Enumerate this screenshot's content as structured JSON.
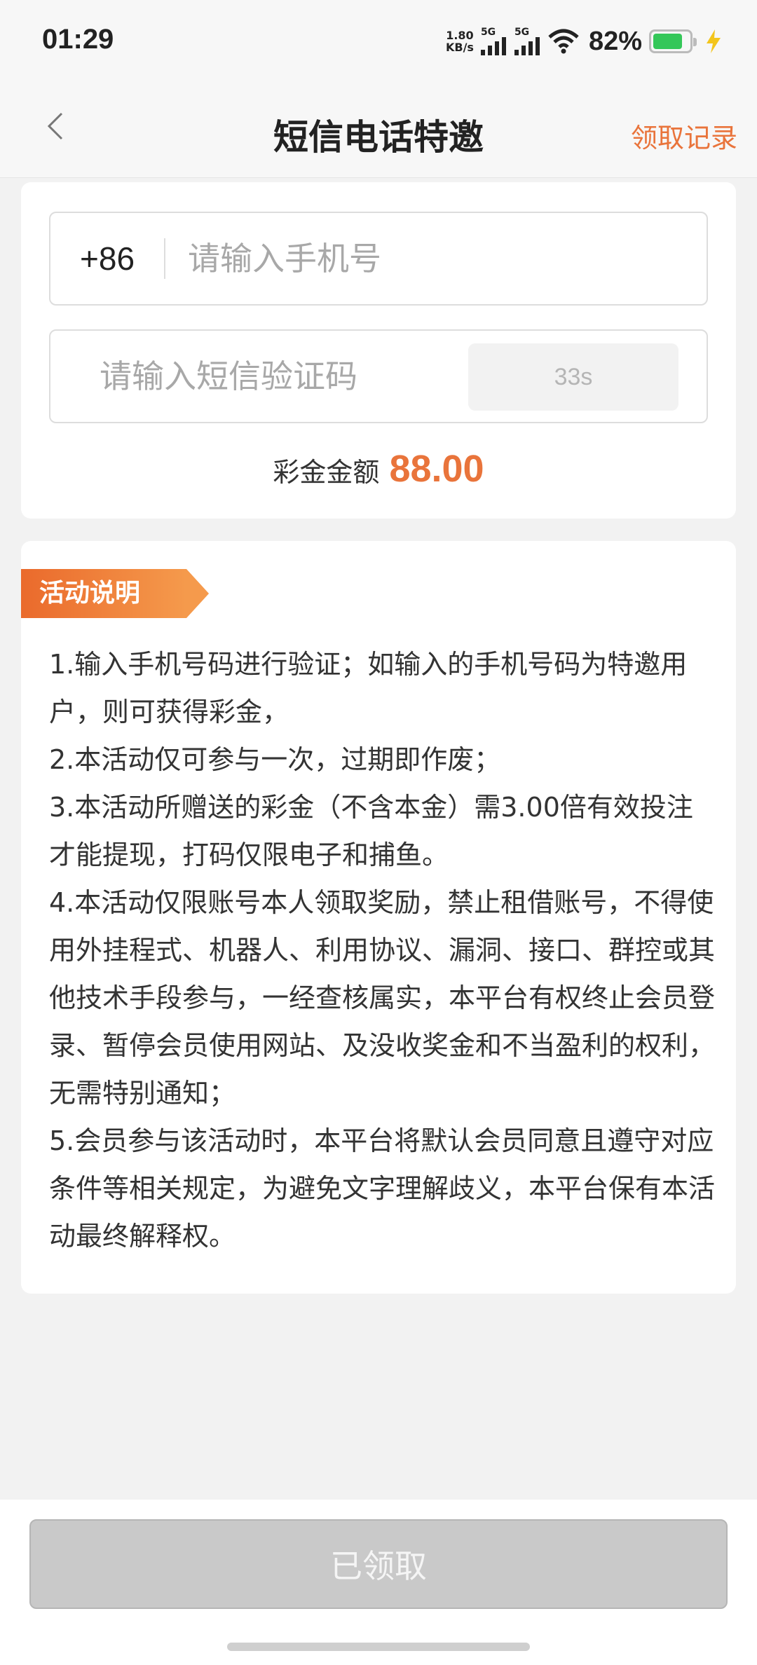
{
  "status_bar": {
    "time": "01:29",
    "net_speed_value": "1.80",
    "net_speed_unit": "KB/s",
    "sim1_label": "5G",
    "sim2_label": "5G",
    "battery_percent": "82%",
    "battery_level": 0.82,
    "icons": [
      "signal-icon",
      "wifi-icon",
      "battery-icon",
      "charging-icon"
    ]
  },
  "nav": {
    "title": "短信电话特邀",
    "right_link": "领取记录",
    "back_icon": "chevron-left-icon"
  },
  "form": {
    "country_code": "+86",
    "phone_placeholder": "请输入手机号",
    "code_placeholder": "请输入短信验证码",
    "countdown_label": "33s",
    "bonus_label": "彩金金额",
    "bonus_value": "88.00"
  },
  "rules": {
    "tag": "活动说明",
    "text": "1.输入手机号码进行验证；如输入的手机号码为特邀用户，则可获得彩金，\n2.本活动仅可参与一次，过期即作废；\n3.本活动所赠送的彩金（不含本金）需3.00倍有效投注才能提现，打码仅限电子和捕鱼。\n4.本活动仅限账号本人领取奖励，禁止租借账号，不得使用外挂程式、机器人、利用协议、漏洞、接口、群控或其他技术手段参与，一经查核属实，本平台有权终止会员登录、暂停会员使用网站、及没收奖金和不当盈利的权利，无需特别通知；\n5.会员参与该活动时，本平台将默认会员同意且遵守对应条件等相关规定，为避免文字理解歧义，本平台保有本活动最终解释权。"
  },
  "footer": {
    "claim_button": "已领取"
  },
  "colors": {
    "accent": "#e9743b",
    "battery": "#34c759",
    "disabled_button": "#c9c9c9"
  }
}
